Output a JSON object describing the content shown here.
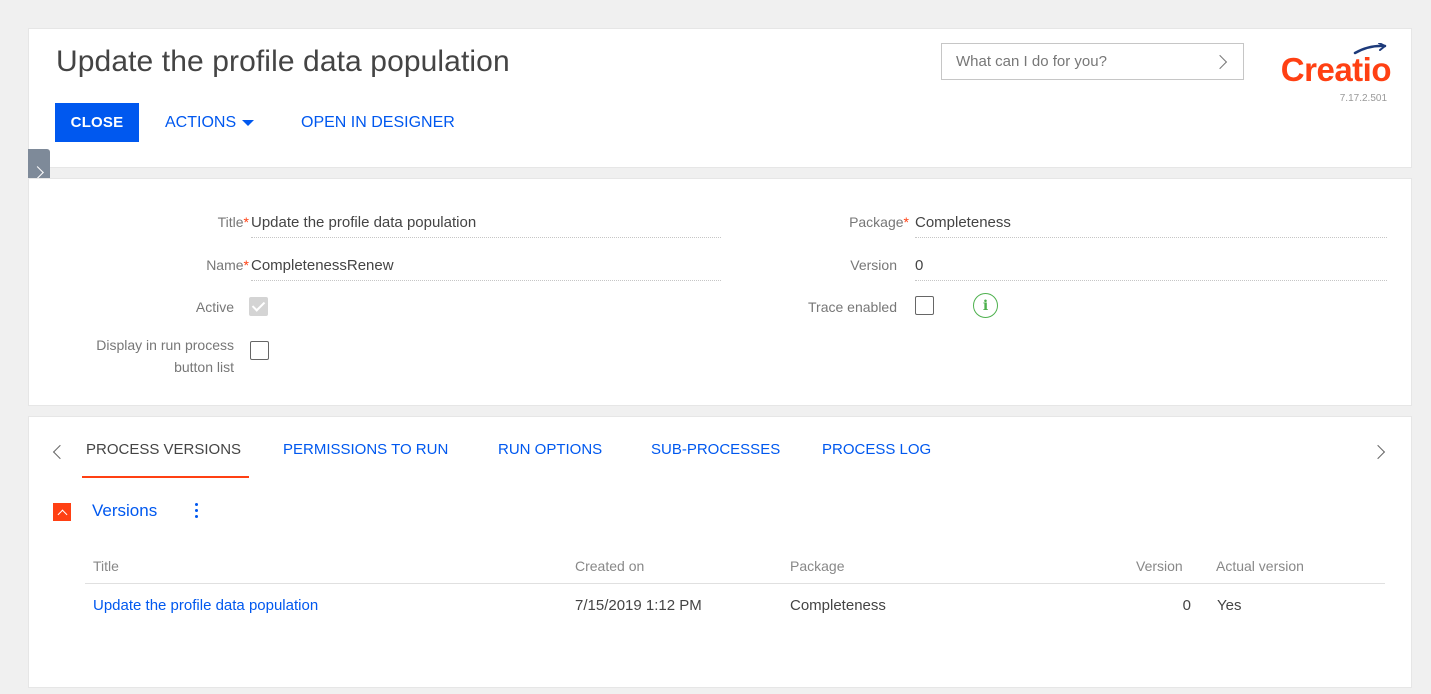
{
  "header": {
    "title": "Update the profile data population",
    "close_label": "CLOSE",
    "actions_label": "ACTIONS",
    "open_designer_label": "OPEN IN DESIGNER",
    "search_placeholder": "What can I do for you?",
    "logo_text": "Creatio",
    "app_version": "7.17.2.501"
  },
  "form": {
    "title_label": "Title",
    "title_value": "Update the profile data population",
    "name_label": "Name",
    "name_value": "CompletenessRenew",
    "active_label": "Active",
    "active_checked": true,
    "display_label_line1": "Display in run process",
    "display_label_line2": "button list",
    "display_checked": false,
    "package_label": "Package",
    "package_value": "Completeness",
    "version_label": "Version",
    "version_value": "0",
    "trace_label": "Trace enabled",
    "trace_checked": false,
    "required_mark": "*"
  },
  "tabs": [
    {
      "label": "PROCESS VERSIONS",
      "active": true
    },
    {
      "label": "PERMISSIONS TO RUN",
      "active": false
    },
    {
      "label": "RUN OPTIONS",
      "active": false
    },
    {
      "label": "SUB-PROCESSES",
      "active": false
    },
    {
      "label": "PROCESS LOG",
      "active": false
    }
  ],
  "versions": {
    "title": "Versions",
    "columns": [
      "Title",
      "Created on",
      "Package",
      "Version",
      "Actual version"
    ],
    "rows": [
      {
        "title": "Update the profile data population",
        "created_on": "7/15/2019 1:12 PM",
        "package": "Completeness",
        "version": "0",
        "actual_version": "Yes"
      }
    ]
  },
  "colors": {
    "accent": "#0058ef",
    "brand": "#ff4013",
    "success": "#4eb14e"
  }
}
